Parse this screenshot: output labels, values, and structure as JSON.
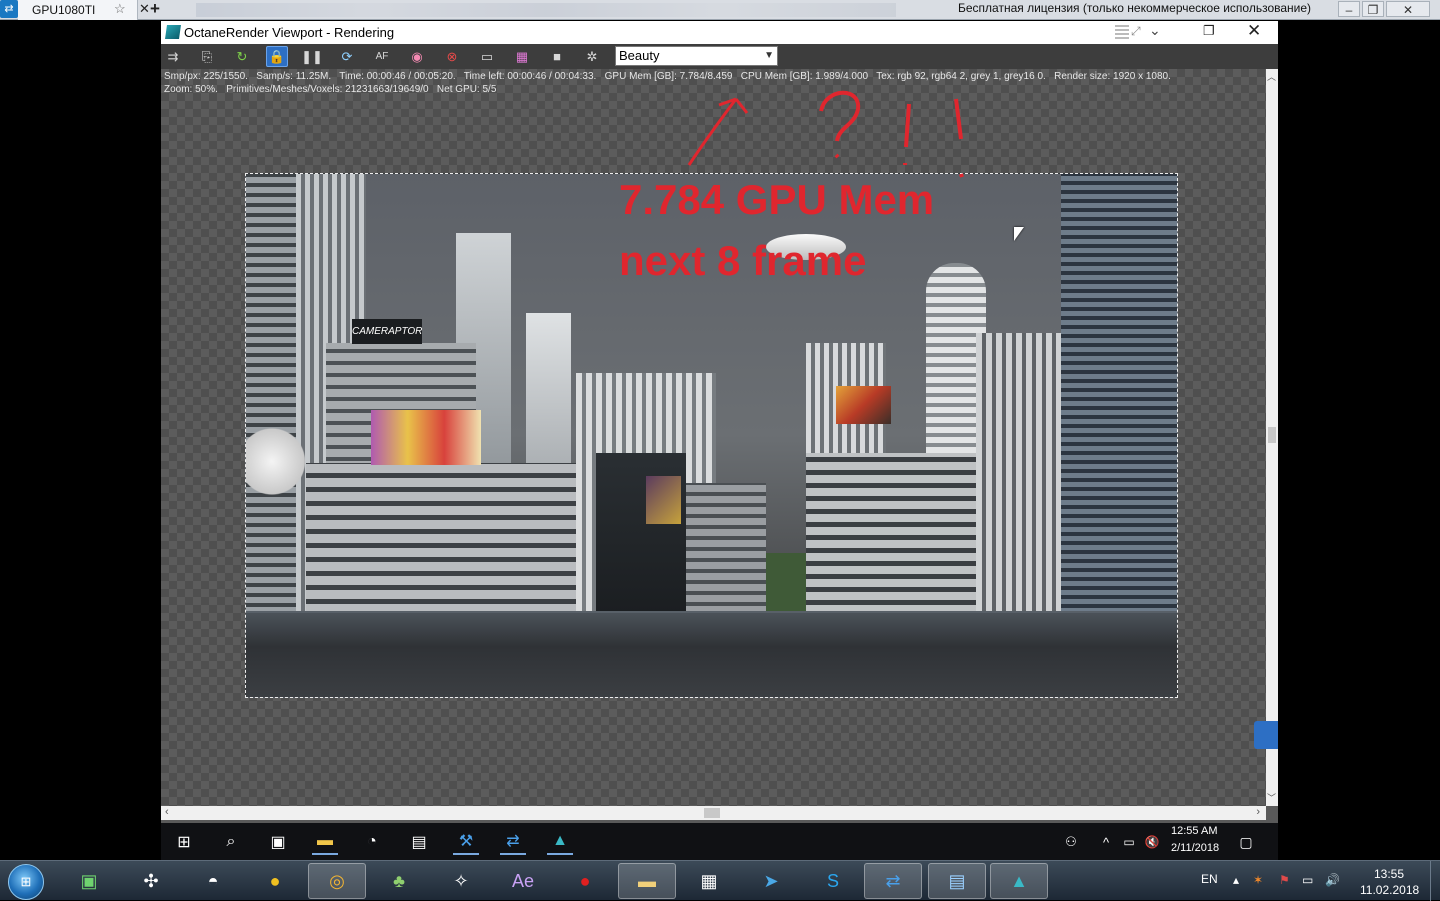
{
  "teamviewer": {
    "tab_label": "GPU1080TI",
    "license_text": "Бесплатная лицензия (только некоммерческое использование)"
  },
  "octane": {
    "window_title": "OctaneRender Viewport - Rendering",
    "render_pass_selected": "Beauty",
    "stats_line1": "Smp/px: 225/1550.   Samp/s: 11.25M.   Time: 00:00:46 / 00:05:20.   Time left: 00:00:46 / 00:04:33.   GPU Mem [GB]: 7.784/8.459   CPU Mem [GB]: 1.989/4.000   Tex: rgb 92, rgb64 2, grey 1, grey16 0.   Render size: 1920 x 1080.",
    "stats_line2": "Zoom: 50%.   Primitives/Meshes/Voxels: 21231663/19649/0   Net GPU: 5/5",
    "annotation_line1": "7.784 GPU Mem",
    "annotation_line2": "next 8 frame",
    "billboard_text": "CAMERAPTOR",
    "accent_color": "#e0262e"
  },
  "remote_taskbar": {
    "time": "12:55 AM",
    "date": "2/11/2018"
  },
  "local_taskbar": {
    "language": "EN",
    "time": "13:55",
    "date": "11.02.2018"
  }
}
